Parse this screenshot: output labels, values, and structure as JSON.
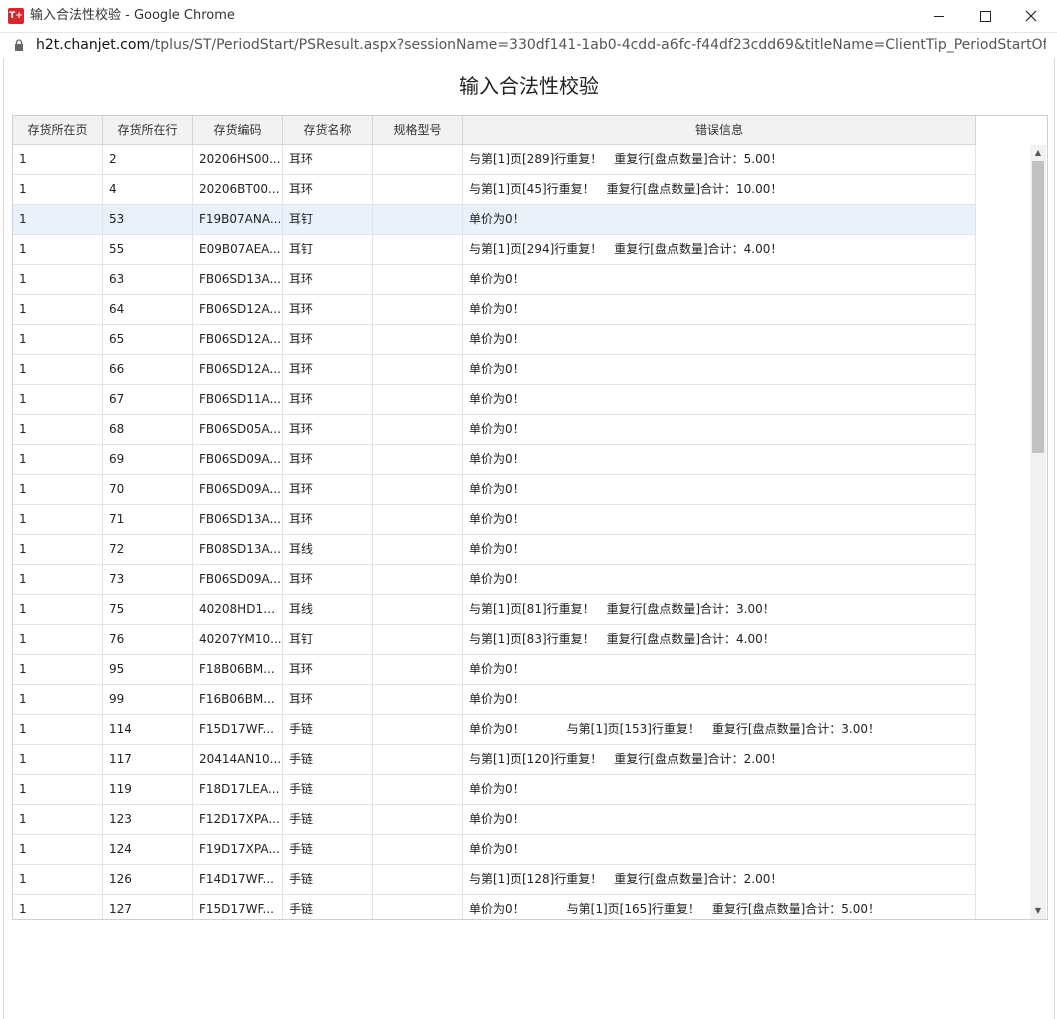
{
  "window": {
    "title": "输入合法性校验 - Google Chrome",
    "logo_text": "T+"
  },
  "address": {
    "host": "h2t.chanjet.com",
    "path": "/tplus/ST/PeriodStart/PSResult.aspx?sessionName=330df141-1ab0-4cdd-a6fc-f44df23cdd69&titleName=ClientTip_PeriodStartOfSt..."
  },
  "page": {
    "title": "输入合法性校验"
  },
  "table": {
    "headers": [
      "存货所在页",
      "存货所在行",
      "存货编码",
      "存货名称",
      "规格型号",
      "错误信息"
    ],
    "rows": [
      {
        "page": "1",
        "line": "2",
        "code": "20206HS00...",
        "name": "耳环",
        "spec": "",
        "error": "与第[1]页[289]行重复！　重复行[盘点数量]合计：5.00！",
        "error2": ""
      },
      {
        "page": "1",
        "line": "4",
        "code": "20206BT00...",
        "name": "耳环",
        "spec": "",
        "error": "与第[1]页[45]行重复！　重复行[盘点数量]合计：10.00！",
        "error2": ""
      },
      {
        "page": "1",
        "line": "53",
        "code": "F19B07ANA...",
        "name": "耳钉",
        "spec": "",
        "error": "单价为0！",
        "error2": ""
      },
      {
        "page": "1",
        "line": "55",
        "code": "E09B07AEA...",
        "name": "耳钉",
        "spec": "",
        "error": "与第[1]页[294]行重复！　重复行[盘点数量]合计：4.00！",
        "error2": ""
      },
      {
        "page": "1",
        "line": "63",
        "code": "FB06SD13A...",
        "name": "耳环",
        "spec": "",
        "error": "单价为0！",
        "error2": ""
      },
      {
        "page": "1",
        "line": "64",
        "code": "FB06SD12A...",
        "name": "耳环",
        "spec": "",
        "error": "单价为0！",
        "error2": ""
      },
      {
        "page": "1",
        "line": "65",
        "code": "FB06SD12A...",
        "name": "耳环",
        "spec": "",
        "error": "单价为0！",
        "error2": ""
      },
      {
        "page": "1",
        "line": "66",
        "code": "FB06SD12A...",
        "name": "耳环",
        "spec": "",
        "error": "单价为0！",
        "error2": ""
      },
      {
        "page": "1",
        "line": "67",
        "code": "FB06SD11A...",
        "name": "耳环",
        "spec": "",
        "error": "单价为0！",
        "error2": ""
      },
      {
        "page": "1",
        "line": "68",
        "code": "FB06SD05A...",
        "name": "耳环",
        "spec": "",
        "error": "单价为0！",
        "error2": ""
      },
      {
        "page": "1",
        "line": "69",
        "code": "FB06SD09A...",
        "name": "耳环",
        "spec": "",
        "error": "单价为0！",
        "error2": ""
      },
      {
        "page": "1",
        "line": "70",
        "code": "FB06SD09A...",
        "name": "耳环",
        "spec": "",
        "error": "单价为0！",
        "error2": ""
      },
      {
        "page": "1",
        "line": "71",
        "code": "FB06SD13A...",
        "name": "耳环",
        "spec": "",
        "error": "单价为0！",
        "error2": ""
      },
      {
        "page": "1",
        "line": "72",
        "code": "FB08SD13A...",
        "name": "耳线",
        "spec": "",
        "error": "单价为0！",
        "error2": ""
      },
      {
        "page": "1",
        "line": "73",
        "code": "FB06SD09A...",
        "name": "耳环",
        "spec": "",
        "error": "单价为0！",
        "error2": ""
      },
      {
        "page": "1",
        "line": "75",
        "code": "40208HD10...",
        "name": "耳线",
        "spec": "",
        "error": "与第[1]页[81]行重复！　重复行[盘点数量]合计：3.00！",
        "error2": ""
      },
      {
        "page": "1",
        "line": "76",
        "code": "40207YM10...",
        "name": "耳钉",
        "spec": "",
        "error": "与第[1]页[83]行重复！　重复行[盘点数量]合计：4.00！",
        "error2": ""
      },
      {
        "page": "1",
        "line": "95",
        "code": "F18B06BM...",
        "name": "耳环",
        "spec": "",
        "error": "单价为0！",
        "error2": ""
      },
      {
        "page": "1",
        "line": "99",
        "code": "F16B06BM...",
        "name": "耳环",
        "spec": "",
        "error": "单价为0！",
        "error2": ""
      },
      {
        "page": "1",
        "line": "114",
        "code": "F15D17WF...",
        "name": "手链",
        "spec": "",
        "error": "单价为0！",
        "error2": "与第[1]页[153]行重复！　重复行[盘点数量]合计：3.00！"
      },
      {
        "page": "1",
        "line": "117",
        "code": "20414AN10...",
        "name": "手链",
        "spec": "",
        "error": "与第[1]页[120]行重复！　重复行[盘点数量]合计：2.00！",
        "error2": ""
      },
      {
        "page": "1",
        "line": "119",
        "code": "F18D17LEA...",
        "name": "手链",
        "spec": "",
        "error": "单价为0！",
        "error2": ""
      },
      {
        "page": "1",
        "line": "123",
        "code": "F12D17XPA...",
        "name": "手链",
        "spec": "",
        "error": "单价为0！",
        "error2": ""
      },
      {
        "page": "1",
        "line": "124",
        "code": "F19D17XPA...",
        "name": "手链",
        "spec": "",
        "error": "单价为0！",
        "error2": ""
      },
      {
        "page": "1",
        "line": "126",
        "code": "F14D17WF...",
        "name": "手链",
        "spec": "",
        "error": "与第[1]页[128]行重复！　重复行[盘点数量]合计：2.00！",
        "error2": ""
      },
      {
        "page": "1",
        "line": "127",
        "code": "F15D17WF...",
        "name": "手链",
        "spec": "",
        "error": "单价为0！",
        "error2": "与第[1]页[165]行重复！　重复行[盘点数量]合计：5.00！"
      }
    ],
    "selected_row_line": "53"
  },
  "icons": {
    "lock": "lock-icon",
    "scroll_up": "scroll-up-arrow-icon",
    "scroll_down": "scroll-down-arrow-icon"
  },
  "colors": {
    "selected_row": "#e8f1fc",
    "header_bg": "#f2f2f2",
    "logo_red": "#d9262f"
  }
}
